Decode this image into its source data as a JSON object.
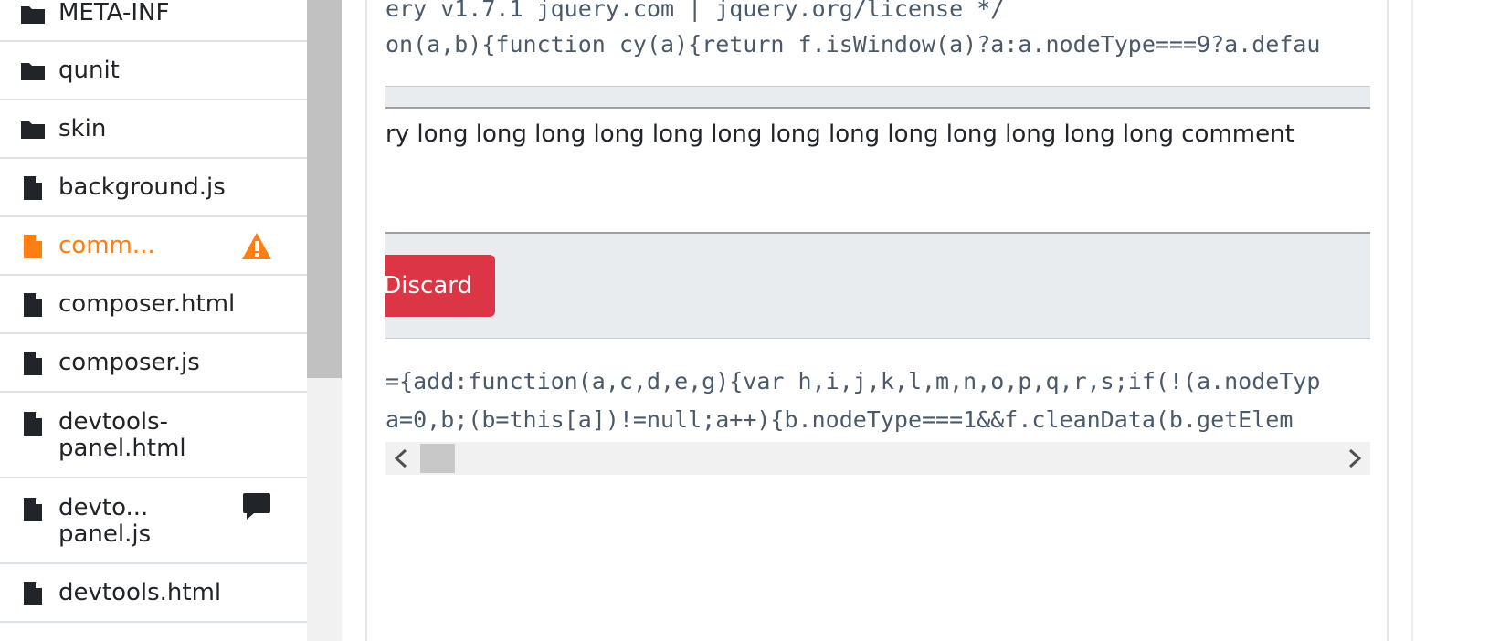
{
  "file_tree": {
    "items": [
      {
        "label": "META-INF",
        "type": "folder"
      },
      {
        "label": "qunit",
        "type": "folder"
      },
      {
        "label": "skin",
        "type": "folder"
      },
      {
        "label": "background.js",
        "type": "file"
      },
      {
        "label": "comm...",
        "type": "file",
        "active": true,
        "badge": "warning-icon"
      },
      {
        "label": "composer.html",
        "type": "file"
      },
      {
        "label": "composer.js",
        "type": "file"
      },
      {
        "label_line1": "devtools-",
        "label_line2": "panel.html",
        "type": "file"
      },
      {
        "label_line1": "devto...",
        "label_line2": "panel.js",
        "type": "file",
        "badge": "comment-icon"
      },
      {
        "label": "devtools.html",
        "type": "file"
      }
    ]
  },
  "code_top": {
    "line1": "ery v1.7.1 jquery.com | jquery.org/license */",
    "line2": "on(a,b){function cy(a){return f.isWindow(a)?a:a.nodeType===9?a.defau"
  },
  "comment": {
    "text": "ry long long long long long long long long long long long long long  comment"
  },
  "actions": {
    "discard_label": "Discard"
  },
  "code_bottom": {
    "line1": "={add:function(a,c,d,e,g){var h,i,j,k,l,m,n,o,p,q,r,s;if(!(a.nodeTyp",
    "line2": "  a=0,b;(b=this[a])!=null;a++){b.nodeType===1&&f.cleanData(b.getElem"
  },
  "colors": {
    "active_file": "#fd7e14",
    "danger": "#dc3545",
    "code_text": "#4a5a6a",
    "panel_gray": "#e9ecef"
  }
}
